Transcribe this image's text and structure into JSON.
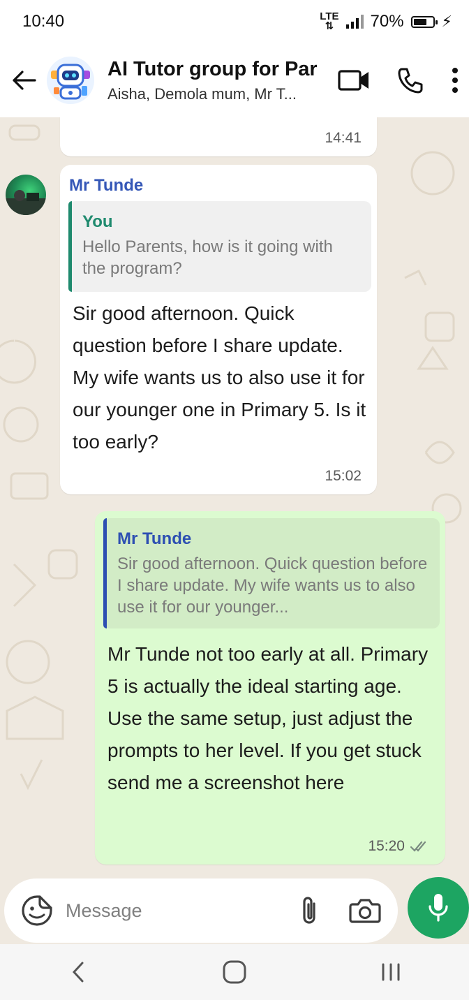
{
  "status_bar": {
    "time": "10:40",
    "network": "LTE",
    "battery": "70%"
  },
  "header": {
    "title": "AI Tutor group for Par",
    "subtitle": "Aisha, Demola mum, Mr T..."
  },
  "messages": [
    {
      "direction": "incoming",
      "time": "14:41"
    },
    {
      "direction": "incoming",
      "sender": "Mr Tunde",
      "quote_author": "You",
      "quote_text": "Hello Parents, how is it going with the program?",
      "text": "Sir good afternoon. Quick question before I share update. My wife wants us to also use it for our younger one in Primary 5. Is it too early?",
      "time": "15:02"
    },
    {
      "direction": "outgoing",
      "quote_author": "Mr Tunde",
      "quote_text": "Sir good afternoon. Quick question before I share update. My wife wants us to also use it for our younger...",
      "text": "Mr Tunde not too early at all. Primary 5 is actually the ideal starting age. Use the same setup, just adjust the prompts to her level. If you get stuck send me a screenshot here",
      "time": "15:20",
      "status_icon": "double-check-icon"
    }
  ],
  "composer": {
    "placeholder": "Message"
  },
  "colors": {
    "accent_green": "#1da562",
    "outgoing_bubble": "#dcfbd0",
    "sender_name": "#3557b7",
    "quote_you": "#1f8a6e"
  }
}
